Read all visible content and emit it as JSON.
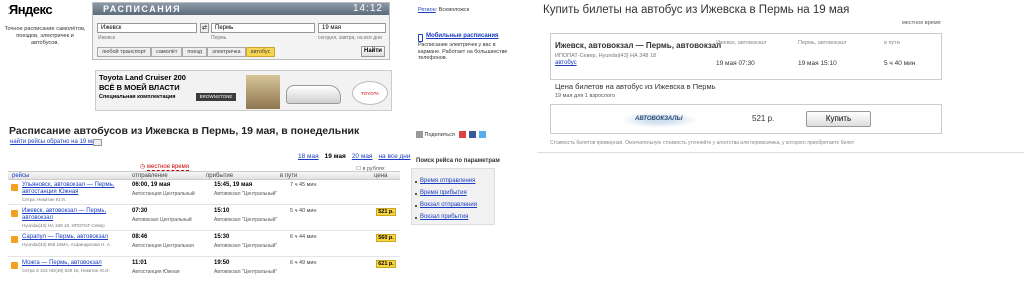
{
  "header": {
    "logo": "Яндекс",
    "tagline": "Точное расписание самолётов, поездов, электричек и автобусов.",
    "service_title": "РАСПИСАНИЯ",
    "clock": "14:12",
    "from_value": "Ижевск",
    "to_value": "Пермь",
    "date_value": "19 мая",
    "swap_label": "⇄",
    "from_hint": "Ижевск",
    "to_hint": "Пермь",
    "date_hints": "сегодня, завтра, на все дни",
    "tabs": [
      "любой транспорт",
      "самолёт",
      "поезд",
      "электричка",
      "автобус"
    ],
    "active_tab": "автобус",
    "find_label": "Найти",
    "region_label": "Регион",
    "region_value": "Всеволожск",
    "mobile_link": "Мобильные расписания",
    "mobile_text": "Расписание электричек у вас в кармане. Работает на большинстве телефонов."
  },
  "ad": {
    "line1": "Toyota Land Cruiser 200",
    "line2": "ВСЁ В МОЕЙ ВЛАСТИ",
    "line3": "Специальная комплектация",
    "badge": "BROWNSTONE",
    "logo": "TOYOTA"
  },
  "main": {
    "title": "Расписание автобусов из Ижевска в Пермь, 19 мая, в понедельник",
    "reverse_link": "найти рейсы обратно на 19 мая",
    "share_label": "Поделиться",
    "date_nav": [
      "18 мая",
      "19 мая",
      "20 мая",
      "на все дни"
    ],
    "active_date": "19 мая",
    "local_time": "местное время",
    "price_unit": "в рублях",
    "columns": {
      "route": "рейсы",
      "dep": "отправление",
      "arr": "прибытие",
      "dur": "в пути",
      "price": "цена"
    },
    "rows": [
      {
        "route": "Ульяновск, автовокзал — Пермь, автостанция Южная",
        "carrier": "Сетра, Никитин Ю.И.",
        "dep_time": "06:00, 19 мая",
        "dep_station": "Автостанция Центральный",
        "arr_time": "15:45, 19 мая",
        "arr_station": "Автовокзал \"Центральный\"",
        "duration": "7 ч 45 мин",
        "price": ""
      },
      {
        "route": "Ижевск, автовокзал — Пермь, автовокзал",
        "carrier": "Hyundai(43) НА 348 18, ИПОПАТ-Север",
        "dep_time": "07:30",
        "dep_station": "Автовокзал Центральный",
        "arr_time": "15:10",
        "arr_station": "Автовокзал \"Центральный\"",
        "duration": "5 ч 40 мин",
        "price": "521 р."
      },
      {
        "route": "Сарапул — Пермь, автовокзал",
        "carrier": "Hyundai(43) 658 18МА, Асфандилова Н. А.",
        "dep_time": "08:46",
        "dep_station": "Автостанция Центральная",
        "arr_time": "15:30",
        "arr_station": "Автовокзал \"Центральный\"",
        "duration": "6 ч 44 мин",
        "price": "560 р."
      },
      {
        "route": "Можга — Пермь, автовокзал",
        "carrier": "Сетра S 315 HD(48) 839 18, Никитин Ю.И.",
        "dep_time": "11:01",
        "dep_station": "Автостанция Южная",
        "arr_time": "19:50",
        "arr_station": "Автовокзал \"Центральный\"",
        "duration": "6 ч 49 мин",
        "price": "621 р."
      }
    ]
  },
  "filters": {
    "title": "Поиск рейса по параметрам",
    "items": [
      "Время отправления",
      "Время прибытия",
      "Вокзал отправления",
      "Вокзал прибытия"
    ]
  },
  "purchase": {
    "title": "Купить билеты на автобус из Ижевска в Пермь на 19 мая",
    "local_time": "местное время",
    "route": "Ижевск, автовокзал — Пермь, автовокзал",
    "carrier": "ИПОПАТ-Север, Hyundai(43) НА 348 18",
    "seller": "автобус",
    "dep_label": "Ижевск, автовокзал",
    "dep_value": "19 мая 07:30",
    "arr_label": "Пермь, автовокзал",
    "arr_value": "19 мая 15:10",
    "dur_label": "в пути",
    "dur_value": "5 ч 40 мин",
    "price_title": "Цена билетов на автобус из Ижевска в Пермь",
    "price_count": "19 мая для 1 взрослого",
    "vendor": "АВТОВОКЗАЛЫ",
    "price": "521 р.",
    "buy_label": "Купить",
    "disclaimer": "Стоимость билетов примерная. Окончательную стоимость уточняйте у агентства или перевозчика, у которого приобретаете билет"
  }
}
